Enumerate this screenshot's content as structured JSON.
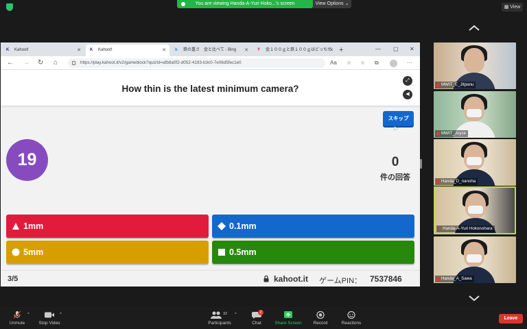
{
  "zoom": {
    "share_banner": "You are viewing Handa-A-Yuri Hoko...'s screen",
    "view_options": "View Options",
    "view_button": "View",
    "participants_count": "32",
    "chat_badge": "2",
    "toolbar": {
      "unmute": "Unmute",
      "stop_video": "Stop Video",
      "participants": "Participants",
      "chat": "Chat",
      "share_screen": "Share Screen",
      "record": "Record",
      "reactions": "Reactions",
      "leave": "Leave"
    },
    "participants": [
      {
        "name": "MWIT_E_Jitpanu"
      },
      {
        "name": "MWIT_Joyce"
      },
      {
        "name": "Handa_D_nanoha"
      },
      {
        "name": "Handa-A-Yuri Hokonohara"
      },
      {
        "name": "Handa_A_Sawa"
      }
    ]
  },
  "browser": {
    "tabs": [
      {
        "label": "Kahoot!",
        "icon": "kahoot-icon"
      },
      {
        "label": "Kahoot!",
        "icon": "kahoot-icon"
      },
      {
        "label": "鉄の重さ　金と比べて - Bing",
        "icon": "bing-icon"
      },
      {
        "label": "金１００ｇと鉄１００ｇはどっちが",
        "icon": "yahoo-icon"
      }
    ],
    "url": "https://play.kahoot.it/v2/gameblock?quizId=afb8a0f2-d052-4193-b3c0-7e06d5fec1e0"
  },
  "kahoot": {
    "question": "How thin is the latest minimum camera?",
    "skip_label": "スキップ",
    "timer": "19",
    "answers_count": "0",
    "answers_label": "件の回答",
    "answers": [
      {
        "label": "1mm",
        "shape": "triangle",
        "color": "#e21b3c"
      },
      {
        "label": "0.1mm",
        "shape": "diamond",
        "color": "#1368ce"
      },
      {
        "label": "5mm",
        "shape": "circle",
        "color": "#d89e00"
      },
      {
        "label": "0.5mm",
        "shape": "square",
        "color": "#26890c"
      }
    ],
    "question_index": "3/5",
    "brand": "kahoot.it",
    "pin_label": "ゲームPIN：",
    "pin": "7537846"
  }
}
